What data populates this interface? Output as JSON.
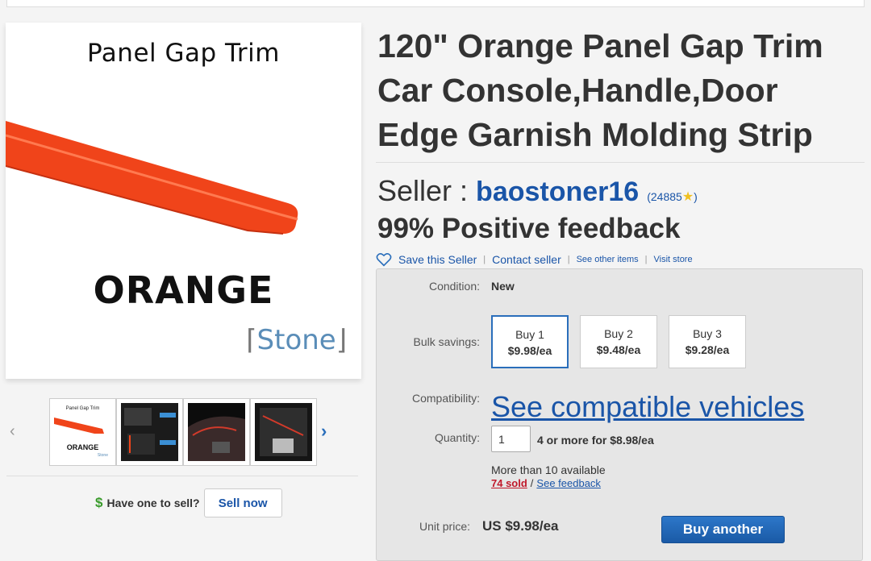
{
  "image": {
    "title": "Panel Gap Trim",
    "color_label": "ORANGE",
    "brand": "Stone",
    "thumb1_title": "Panel Gap Trim",
    "thumb1_color": "ORANGE",
    "thumb1_brand": "Stone",
    "strip_color": "#f0441a"
  },
  "listing": {
    "title": "120\" Orange Panel Gap Trim Car Console,Handle,Door Edge Garnish Molding Strip"
  },
  "seller": {
    "label": "Seller :",
    "name": "baostoner16",
    "score_open": "(24885",
    "score_close": ")",
    "feedback": "99% Positive feedback",
    "save": "Save this Seller",
    "contact": "Contact seller",
    "see_other": "See other items",
    "visit": "Visit store"
  },
  "details": {
    "condition_label": "Condition:",
    "condition_value": "New",
    "bulk_label": "Bulk savings:",
    "bulk_options": [
      {
        "qty": "Buy 1",
        "price": "$9.98/ea"
      },
      {
        "qty": "Buy 2",
        "price": "$9.48/ea"
      },
      {
        "qty": "Buy 3",
        "price": "$9.28/ea"
      }
    ],
    "compat_label": "Compatibility:",
    "compat_link": "See compatible vehicles",
    "qty_label": "Quantity:",
    "qty_value": "1",
    "qty_note": "4 or more for $8.98/ea",
    "available": "More than 10 available",
    "sold": "74 sold",
    "see_feedback": "See feedback",
    "unit_label": "Unit price:",
    "unit_value": "US $9.98/ea",
    "buy_another": "Buy another"
  },
  "sell": {
    "question": "Have one to sell?",
    "button": "Sell now"
  },
  "colors": {
    "link": "#1a55a8",
    "accent": "#2a6ebb",
    "sold": "#c0182a",
    "dollar": "#3a9b2c"
  }
}
